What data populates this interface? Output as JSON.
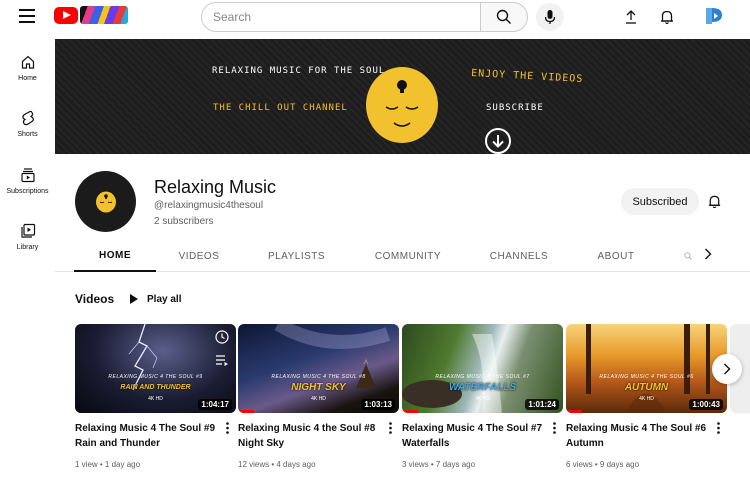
{
  "header": {
    "search_placeholder": "Search",
    "icons": [
      "menu-icon",
      "youtube-logo",
      "search-icon",
      "microphone-icon",
      "upload-icon",
      "notifications-icon",
      "account-icon"
    ]
  },
  "sidebar": {
    "items": [
      {
        "label": "Home",
        "icon": "home-icon"
      },
      {
        "label": "Shorts",
        "icon": "shorts-icon"
      },
      {
        "label": "Subscriptions",
        "icon": "subscriptions-icon"
      },
      {
        "label": "Library",
        "icon": "library-icon"
      }
    ]
  },
  "banner": {
    "line1": "RELAXING MUSIC FOR THE SOUL",
    "line2": "THE CHILL OUT CHANNEL",
    "line3": "ENJOY THE VIDEOS",
    "line4": "SUBSCRIBE",
    "color_white": "#ffffff",
    "color_yellow": "#f2c12e"
  },
  "channel": {
    "name": "Relaxing Music",
    "handle": "@relaxingmusic4thesoul",
    "subscribers": "2 subscribers",
    "subscribe_button": "Subscribed"
  },
  "tabs": [
    "HOME",
    "VIDEOS",
    "PLAYLISTS",
    "COMMUNITY",
    "CHANNELS",
    "ABOUT"
  ],
  "active_tab": "HOME",
  "section": {
    "title": "Videos",
    "play_all": "Play all"
  },
  "videos": [
    {
      "thumb_line1": "RELAXING MUSIC 4 THE SOUL #9",
      "thumb_line2": "RAIN AND THUNDER",
      "thumb_line3": "4K HD",
      "thumb_color": "#f2c12e",
      "duration": "1:04:17",
      "watched_fraction": 0,
      "title": "Relaxing Music 4 The Soul #9 Rain and Thunder",
      "meta": "1 view • 1 day ago"
    },
    {
      "thumb_line1": "RELAXING MUSIC 4 THE SOUL #8",
      "thumb_line2": "NIGHT SKY",
      "thumb_line3": "4K HD",
      "thumb_color": "#f2c12e",
      "duration": "1:03:13",
      "watched_fraction": 0.1,
      "title": "Relaxing Music 4 the Soul #8 Night Sky",
      "meta": "12 views • 4 days ago"
    },
    {
      "thumb_line1": "RELAXING MUSIC 4 THE SOUL #7",
      "thumb_line2": "WATERFALLS",
      "thumb_line3": "4K HD",
      "thumb_color": "#3fa7e6",
      "duration": "1:01:24",
      "watched_fraction": 0.1,
      "title": "Relaxing Music 4 The Soul #7 Waterfalls",
      "meta": "3 views • 7 days ago"
    },
    {
      "thumb_line1": "RELAXING MUSIC 4 THE SOUL #6",
      "thumb_line2": "AUTUMN",
      "thumb_line3": "4K HD",
      "thumb_color": "#f2c12e",
      "duration": "1:00:43",
      "watched_fraction": 0.1,
      "title": "Relaxing Music 4 The Soul #6 Autumn",
      "meta": "6 views • 9 days ago"
    }
  ]
}
